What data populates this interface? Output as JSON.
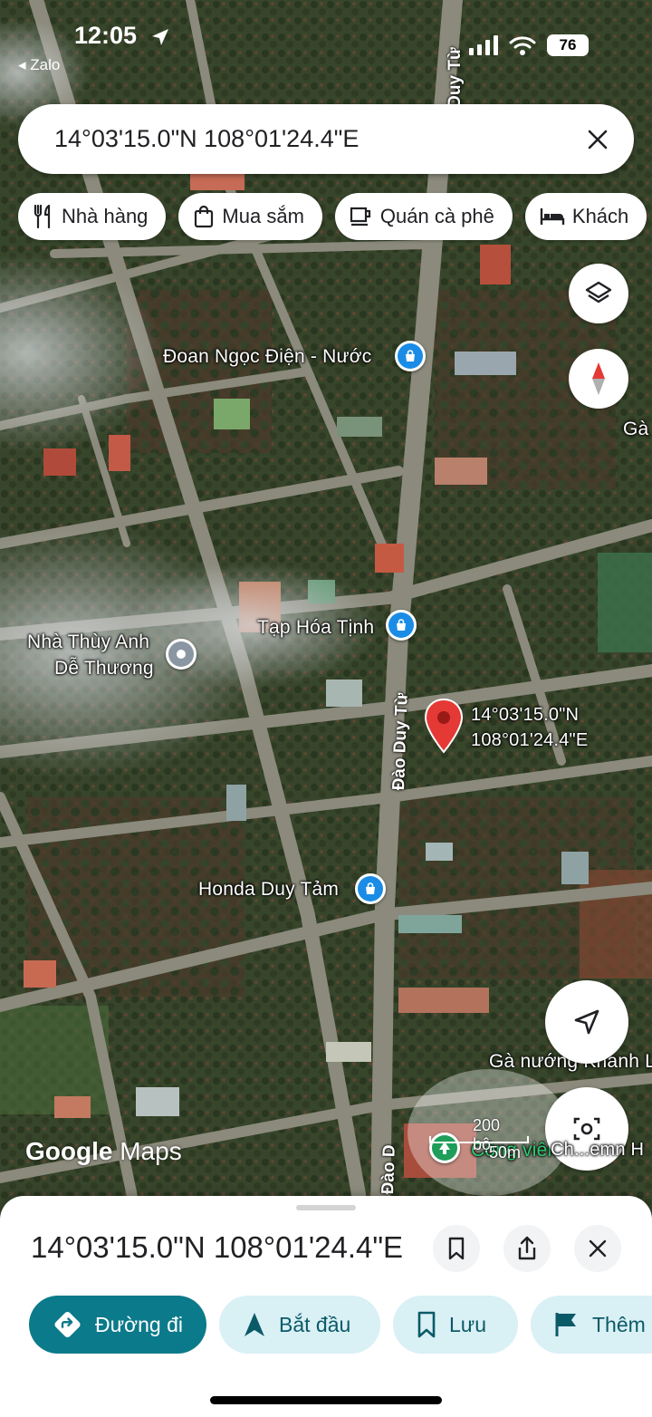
{
  "status_bar": {
    "time": "12:05",
    "back_app": "◂ Zalo",
    "battery": "76"
  },
  "search": {
    "value": "14°03'15.0\"N 108°01'24.4\"E"
  },
  "chips": [
    {
      "label": "Nhà hàng",
      "icon": "fork-knife-icon"
    },
    {
      "label": "Mua sắm",
      "icon": "shopping-bag-icon"
    },
    {
      "label": "Quán cà phê",
      "icon": "coffee-cup-icon"
    },
    {
      "label": "Khách",
      "icon": "bed-icon"
    }
  ],
  "map": {
    "labels": {
      "doan_ngoc_dien": "Đoan Ngọc Điện - Nước",
      "tap_hoa_tinh": "Tạp Hóa Tịnh",
      "nha_thuy_anh_1": "Nhà Thùy Anh",
      "nha_thuy_anh_2": "Dễ Thương",
      "honda": "Honda Duy Tảm",
      "ga_nuong": "Gà nướng Khanh L",
      "ga_right": "Gà",
      "cong_vien": "Công viên",
      "chem": "Ch...emn H"
    },
    "roads": {
      "top": "Đào Duy Từ",
      "middle": "Đào Duy Từ",
      "bottom": "Đào D"
    },
    "pin_label_1": "14°03'15.0\"N",
    "pin_label_2": "108°01'24.4\"E",
    "scale_top": "200 bộ",
    "scale_bottom": "50m",
    "logo": {
      "google": "Google",
      "maps": "Maps"
    },
    "colors": {
      "pin": "#e53935",
      "poi": "#1a8ce6"
    }
  },
  "sheet": {
    "title": "14°03'15.0\"N 108°01'24.4\"E",
    "actions": {
      "directions": "Đường đi",
      "start": "Bắt đầu",
      "save": "Lưu",
      "more": "Thêm"
    }
  }
}
